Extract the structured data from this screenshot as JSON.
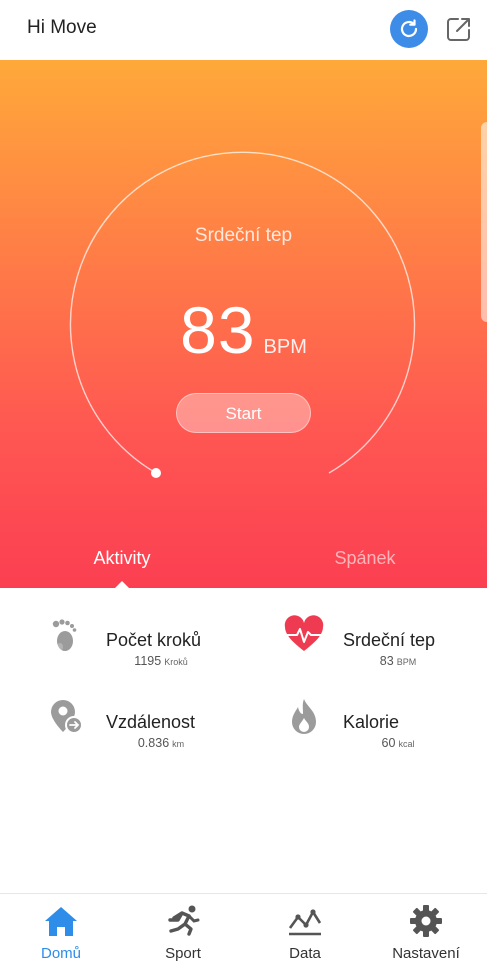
{
  "app": {
    "title": "Hi Move"
  },
  "colors": {
    "accent": "#2e8de8",
    "heart": "#ef3b52",
    "gradient_top": "#ffa93a",
    "gradient_bottom": "#fb3f52"
  },
  "heart_rate": {
    "label": "Srdeční tep",
    "value": "83",
    "unit": "BPM",
    "start_label": "Start"
  },
  "tabs": [
    {
      "label": "Aktivity",
      "active": true
    },
    {
      "label": "Spánek",
      "active": false
    }
  ],
  "stats": [
    {
      "title": "Počet kroků",
      "value": "1195",
      "unit": "Kroků",
      "icon": "footprints-icon"
    },
    {
      "title": "Srdeční tep",
      "value": "83",
      "unit": "BPM",
      "icon": "heart-pulse-icon"
    },
    {
      "title": "Vzdálenost",
      "value": "0.836",
      "unit": "km",
      "icon": "location-pin-icon"
    },
    {
      "title": "Kalorie",
      "value": "60",
      "unit": "kcal",
      "icon": "flame-icon"
    }
  ],
  "nav": [
    {
      "label": "Domů",
      "icon": "home-icon",
      "active": true
    },
    {
      "label": "Sport",
      "icon": "running-icon",
      "active": false
    },
    {
      "label": "Data",
      "icon": "chart-icon",
      "active": false
    },
    {
      "label": "Nastavení",
      "icon": "gear-icon",
      "active": false
    }
  ]
}
